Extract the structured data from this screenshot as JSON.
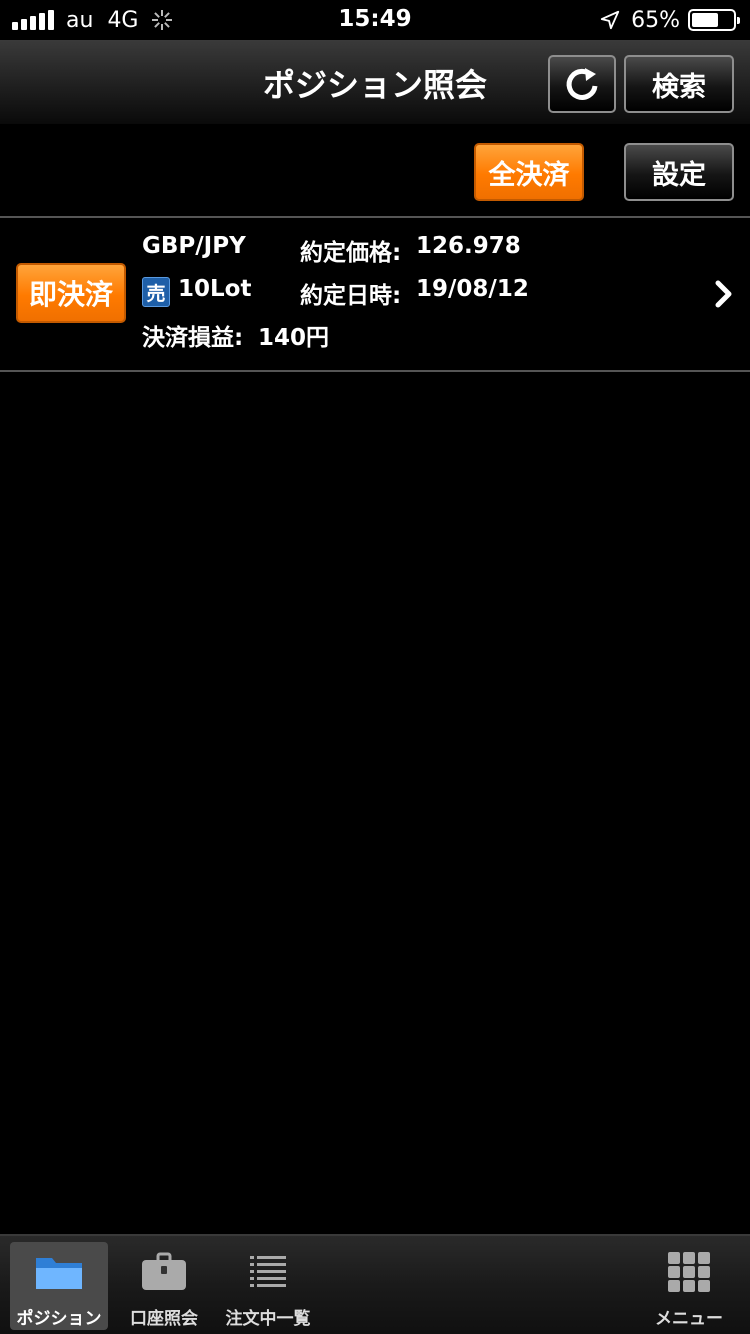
{
  "status_bar": {
    "carrier": "au",
    "network": "4G",
    "time": "15:49",
    "battery_percent": "65%",
    "battery_level": 0.65
  },
  "nav": {
    "title": "ポジション照会",
    "refresh_icon": "refresh-icon",
    "search_label": "検索"
  },
  "toolbar": {
    "close_all_label": "全決済",
    "settings_label": "設定"
  },
  "positions": [
    {
      "quick_close_label": "即決済",
      "pair": "GBP/JPY",
      "side": "売",
      "lots": "10Lot",
      "price_label": "約定価格:",
      "price": "126.978",
      "date_label": "約定日時:",
      "date": "19/08/12",
      "pl_label": "決済損益:",
      "pl": "140円"
    }
  ],
  "tabs": [
    {
      "label": "ポジション",
      "icon": "folder-icon",
      "active": true
    },
    {
      "label": "口座照会",
      "icon": "briefcase-icon",
      "active": false
    },
    {
      "label": "注文中一覧",
      "icon": "list-icon",
      "active": false
    },
    {
      "label": "メニュー",
      "icon": "grid-icon",
      "active": false
    }
  ],
  "colors": {
    "accent_orange": "#ff7a00",
    "sell_badge_blue": "#1e5fa8",
    "background": "#000000"
  }
}
